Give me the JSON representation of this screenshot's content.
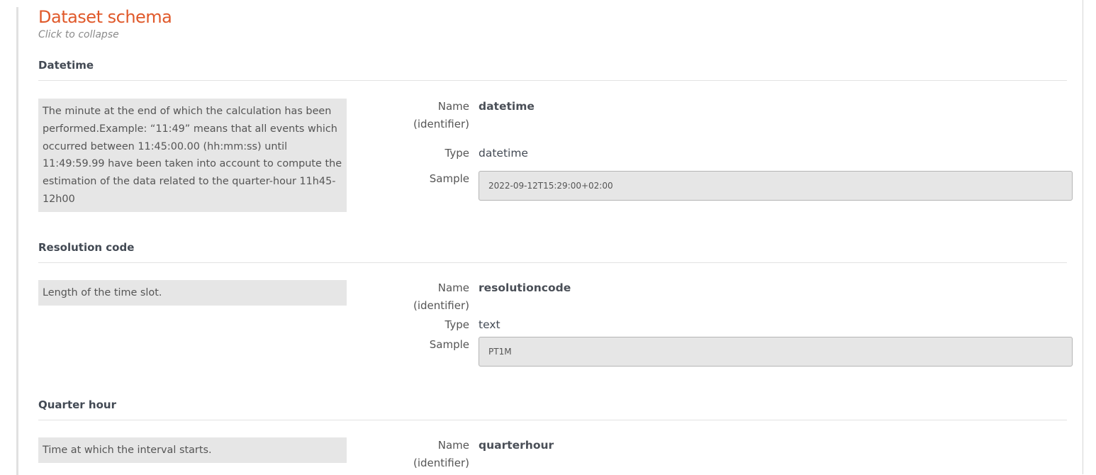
{
  "schema": {
    "title": "Dataset schema",
    "subtitle": "Click to collapse"
  },
  "labels": {
    "name": "Name",
    "identifier": "(identifier)",
    "type": "Type",
    "sample": "Sample"
  },
  "fields": [
    {
      "title": "Datetime",
      "description": "The minute at the end of which the calculation has been performed.Example: “11:49” means that all events which occurred between 11:45:00.00 (hh:mm:ss) until 11:49:59.99 have been taken into account to compute the estimation of the data related to the quarter-hour 11h45-12h00",
      "name": "datetime",
      "type": "datetime",
      "sample": "2022-09-12T15:29:00+02:00"
    },
    {
      "title": "Resolution code",
      "description": "Length of the time slot.",
      "name": "resolutioncode",
      "type": "text",
      "sample": "PT1M"
    },
    {
      "title": "Quarter hour",
      "description": "Time at which the interval starts.",
      "name": "quarterhour"
    }
  ]
}
